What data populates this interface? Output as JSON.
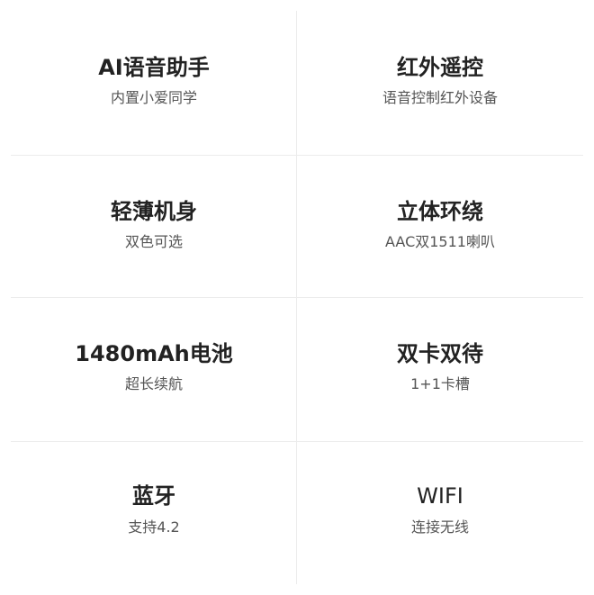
{
  "features": [
    {
      "title": "AI语音助手",
      "subtitle": "内置小爱同学"
    },
    {
      "title": "红外遥控",
      "subtitle": "语音控制红外设备"
    },
    {
      "title": "轻薄机身",
      "subtitle": "双色可选"
    },
    {
      "title": "立体环绕",
      "subtitle": "AAC双1511喇叭"
    },
    {
      "title": "1480mAh电池",
      "subtitle": "超长续航"
    },
    {
      "title": "双卡双待",
      "subtitle": "1+1卡槽"
    },
    {
      "title": "蓝牙",
      "subtitle": "支持4.2"
    },
    {
      "title": "WIFI",
      "subtitle": "连接无线"
    }
  ]
}
